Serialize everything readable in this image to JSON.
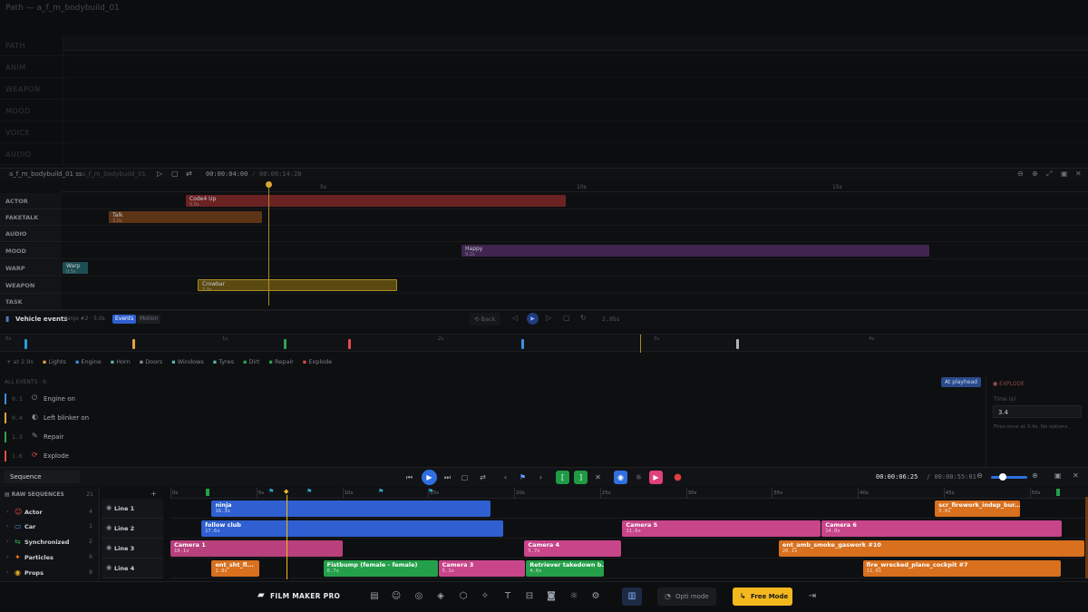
{
  "path_panel": {
    "title": "Path — a_f_m_bodybuild_01",
    "rows": [
      "PATH",
      "ANIM",
      "WEAPON",
      "MOOD",
      "VOICE",
      "AUDIO"
    ]
  },
  "clip_editor": {
    "name": "a_f_m_bodybuild_01 ss",
    "sub": "a_f_m_bodybuild_01",
    "time_current": "00:00:04:00",
    "time_total": "00:00:14:28",
    "ruler": [
      "5s",
      "10s",
      "15s"
    ],
    "tracks": [
      {
        "label": "ACTOR",
        "clip": "Code4 Up",
        "dur": "5.0s",
        "color": "#6b2222"
      },
      {
        "label": "FAKETALK",
        "clip": "Talk",
        "dur": "3.0s",
        "color": "#5e3416"
      },
      {
        "label": "AUDIO",
        "clip": "",
        "dur": "",
        "color": ""
      },
      {
        "label": "MOOD",
        "clip": "Happy",
        "dur": "9.2s",
        "color": "#40264f"
      },
      {
        "label": "WARP",
        "clip": "Warp",
        "dur": "0.5s",
        "color": "#1d4e52"
      },
      {
        "label": "WEAPON",
        "clip": "Crowbar",
        "dur": "3.9s",
        "color": "#5a4a12"
      },
      {
        "label": "TASK",
        "clip": "",
        "dur": "",
        "color": ""
      }
    ]
  },
  "vehicle": {
    "title": "Vehicle events",
    "sub": "Kanjo #2 · 5.0s",
    "tab_events": "Events",
    "tab_motion": "Motion",
    "back": "Back",
    "playhead": "2.95s",
    "ruler": [
      "0s",
      "1s",
      "2s",
      "3s",
      "4s"
    ],
    "add_time": "+ at 2.9s",
    "legend": [
      {
        "label": "Lights",
        "color": "#e6a23c"
      },
      {
        "label": "Engine",
        "color": "#3a8ee6"
      },
      {
        "label": "Horn",
        "color": "#5fb3b3"
      },
      {
        "label": "Doors",
        "color": "#8a8f96"
      },
      {
        "label": "Windows",
        "color": "#5fb3b3"
      },
      {
        "label": "Tyres",
        "color": "#5fb3b3"
      },
      {
        "label": "Dirt",
        "color": "#2ea44f"
      },
      {
        "label": "Repair",
        "color": "#2ea44f"
      },
      {
        "label": "Explode",
        "color": "#e64a4a"
      }
    ],
    "all_events_label": "ALL EVENTS · 6",
    "at_playhead": "At playhead",
    "events": [
      {
        "time": "0.1",
        "icon": "power-icon",
        "glyph": "⏻",
        "text": "Engine on",
        "color": "#3a8ee6"
      },
      {
        "time": "0.4",
        "icon": "blinker-icon",
        "glyph": "◐",
        "text": "Left blinker on",
        "color": "#e6a23c"
      },
      {
        "time": "1.3",
        "icon": "wrench-icon",
        "glyph": "✎",
        "text": "Repair",
        "color": "#2ea44f"
      },
      {
        "time": "1.6",
        "icon": "explode-icon",
        "glyph": "⟳",
        "text": "Explode",
        "color": "#e64a4a"
      }
    ],
    "inspector": {
      "title": "EXPLODE",
      "time_label": "Time (s)",
      "time_value": "3.4",
      "note": "Fires once at 3.4s. No options."
    }
  },
  "sequence": {
    "title": "Sequence",
    "time_current": "00:00:06:25",
    "time_total": "00:00:55:01",
    "raw_label": "RAW SEQUENCES",
    "raw_count": "21",
    "categories": [
      {
        "label": "Actor",
        "count": "4",
        "glyph": "☺",
        "color": "#e64a4a"
      },
      {
        "label": "Car",
        "count": "1",
        "glyph": "▭",
        "color": "#3a8ee6"
      },
      {
        "label": "Synchronized",
        "count": "2",
        "glyph": "⇆",
        "color": "#2ea44f"
      },
      {
        "label": "Particles",
        "count": "6",
        "glyph": "✦",
        "color": "#f07a20"
      },
      {
        "label": "Props",
        "count": "8",
        "glyph": "◉",
        "color": "#e6b020"
      }
    ],
    "ruler": [
      "0s",
      "5s",
      "10s",
      "15s",
      "20s",
      "25s",
      "30s",
      "35s",
      "40s",
      "45s",
      "50s"
    ],
    "lines": [
      {
        "label": "Line 1",
        "clips": [
          {
            "name": "ninja",
            "dur": "16.3s",
            "color": "#2f5fd0",
            "start": 2.4,
            "len": 16.3
          },
          {
            "name": "scr_firework_indep_bur...",
            "dur": "5.0s",
            "color": "#d8701e",
            "start": 44.5,
            "len": 5.0
          }
        ]
      },
      {
        "label": "Line 2",
        "clips": [
          {
            "name": "follow club",
            "dur": "17.6s",
            "color": "#2f5fd0",
            "start": 1.8,
            "len": 17.6
          },
          {
            "name": "Camera 5",
            "dur": "11.6s",
            "color": "#c8458a",
            "start": 26.3,
            "len": 11.6
          },
          {
            "name": "Camera 6",
            "dur": "14.0s",
            "color": "#c8458a",
            "start": 37.9,
            "len": 14.0
          }
        ]
      },
      {
        "label": "Line 3",
        "clips": [
          {
            "name": "Camera 1",
            "dur": "10.1s",
            "color": "#b8407c",
            "start": 0.0,
            "len": 10.1
          },
          {
            "name": "Camera 4",
            "dur": "5.7s",
            "color": "#c8458a",
            "start": 20.6,
            "len": 5.7
          },
          {
            "name": "ent_amb_smoke_gaswork #10",
            "dur": "20.1s",
            "color": "#d8701e",
            "start": 35.4,
            "len": 20.1
          }
        ]
      },
      {
        "label": "Line 4",
        "clips": [
          {
            "name": "ent_sht_fl...",
            "dur": "2.8s",
            "color": "#d8701e",
            "start": 2.4,
            "len": 2.8
          },
          {
            "name": "Fistbump (female - female)",
            "dur": "6.7s",
            "color": "#24a04a",
            "start": 8.9,
            "len": 6.7
          },
          {
            "name": "Camera 3",
            "dur": "5.1s",
            "color": "#c8458a",
            "start": 15.6,
            "len": 5.1
          },
          {
            "name": "Retriever takedown b...",
            "dur": "4.6s",
            "color": "#24a04a",
            "start": 20.7,
            "len": 4.6
          },
          {
            "name": "fire_wrecked_plane_cockpit #7",
            "dur": "11.6s",
            "color": "#d8701e",
            "start": 40.3,
            "len": 11.6
          }
        ]
      }
    ]
  },
  "bottom_bar": {
    "brand": "FILM MAKER PRO",
    "opti_mode": "Opti mode",
    "free_mode": "Free Mode"
  },
  "colors": {
    "accent": "#2f6fe0",
    "yellow": "#f2b81e",
    "green": "#24a04a",
    "pink": "#e0407a"
  }
}
